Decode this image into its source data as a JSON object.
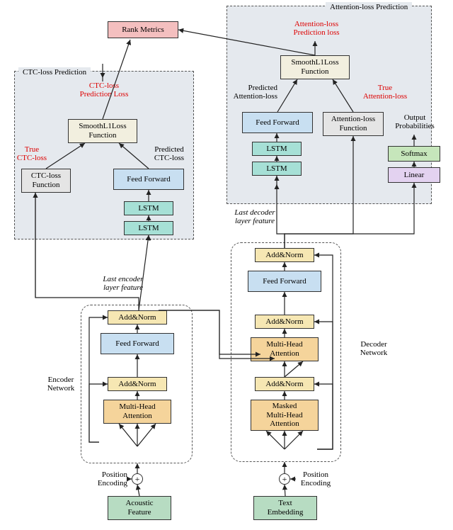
{
  "diagram": {
    "rank_metrics": "Rank Metrics",
    "ctc_group_title": "CTC-loss Prediction",
    "att_group_title": "Attention-loss Prediction",
    "ctc_pred_loss": "CTC-loss\nPrediction Loss",
    "att_pred_loss": "Attention-loss\nPrediction loss",
    "smooth_left": "SmoothL1Loss\nFunction",
    "smooth_right": "SmoothL1Loss\nFunction",
    "true_ctc": "True\nCTC-loss",
    "pred_ctc": "Predicted\nCTC-loss",
    "true_att": "True\nAttention-loss",
    "pred_att": "Predicted\nAttention-loss",
    "ctc_loss_fn": "CTC-loss\nFunction",
    "att_loss_fn": "Attention-loss\nFunction",
    "feed_forward": "Feed Forward",
    "lstm": "LSTM",
    "last_enc_feat": "Last encoder\nlayer feature",
    "last_dec_feat": "Last decoder\nlayer feature",
    "add_norm": "Add&Norm",
    "multi_head_attention": "Multi-Head\nAttention",
    "masked_mha": "Masked\nMulti-Head\nAttention",
    "softmax": "Softmax",
    "linear": "Linear",
    "output_prob": "Output\nProbabilities",
    "encoder_network": "Encoder\nNetwork",
    "decoder_network": "Decoder\nNetwork",
    "position_encoding": "Position\nEncoding",
    "acoustic_feature": "Acoustic\nFeature",
    "text_embedding": "Text\nEmbedding"
  }
}
